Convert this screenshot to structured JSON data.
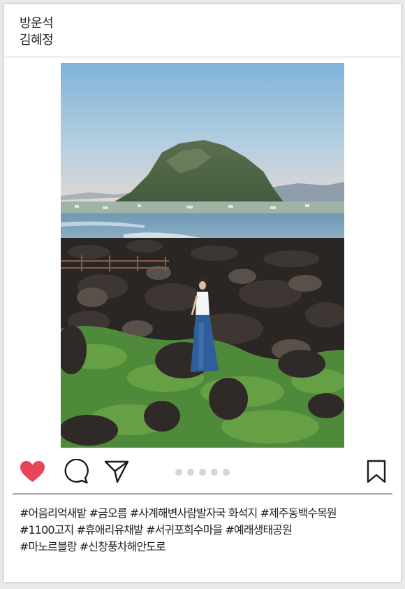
{
  "post": {
    "authors": [
      "방운석",
      "김혜정"
    ],
    "photo": {
      "icon": "coastal-landscape-photo",
      "subject": "woman standing on black volcanic rocks by the sea in front of a mountain"
    }
  },
  "actions": {
    "like_icon": "heart-icon",
    "comment_icon": "comment-icon",
    "share_icon": "paper-plane-icon",
    "save_icon": "bookmark-icon",
    "liked": true,
    "carousel": {
      "total": 5,
      "active": 0
    }
  },
  "tags": {
    "lines": [
      "#어음리억새밭 #금오름 #사계해변사람발자국 화석지 #제주동백수목원",
      "#1100고지 #휴애리유채밭 #서귀포희수마을 #예래생태공원",
      "#마노르블랑 #신창풍차해안도로"
    ]
  },
  "colors": {
    "heart": "#e8445a",
    "icon_stroke": "#1a1a1a",
    "dot": "#d6d6d6",
    "divider": "#a9a9a9",
    "card": "#ffffff",
    "background": "#e9e9e9"
  }
}
